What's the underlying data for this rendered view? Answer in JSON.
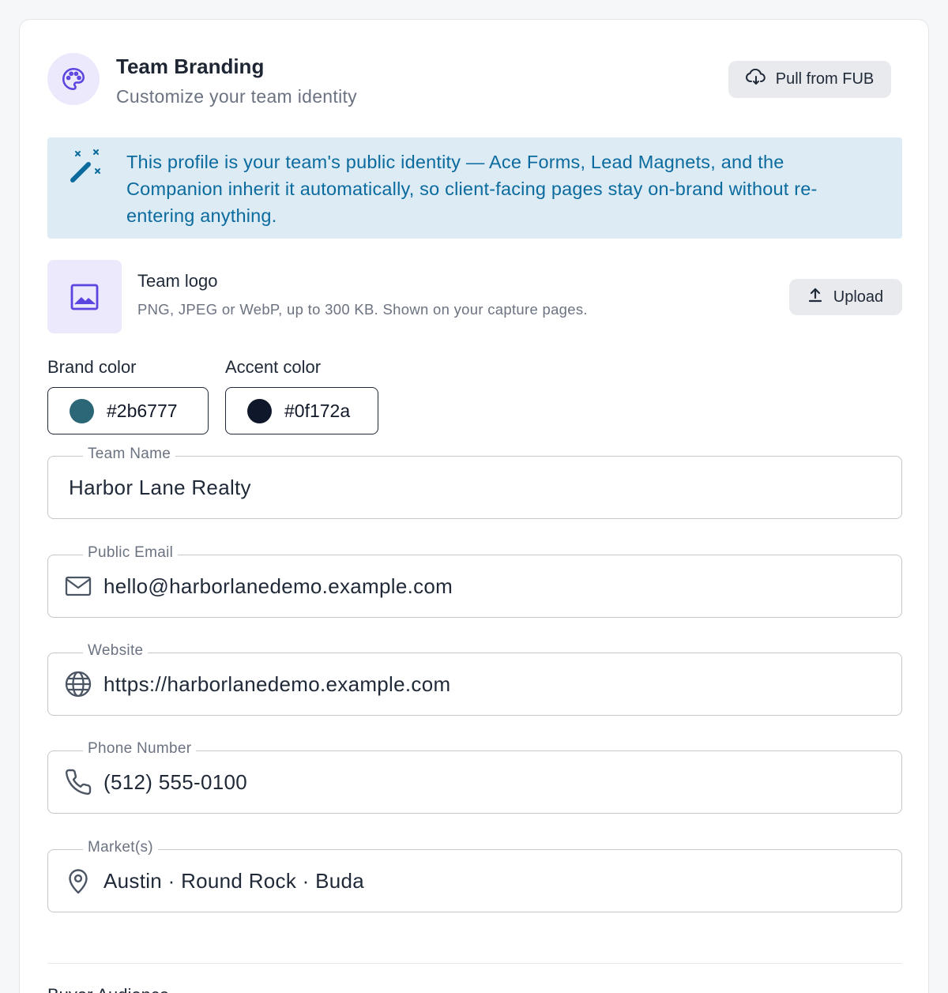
{
  "header": {
    "title": "Team Branding",
    "subtitle": "Customize your team identity",
    "pull_label": "Pull from FUB",
    "icon": "palette-icon"
  },
  "info": {
    "text": "This profile is your team's public identity — Ace Forms, Lead Magnets, and the Companion inherit it automatically, so client-facing pages stay on-brand without re-entering anything.",
    "icon": "magic-wand-icon"
  },
  "logo": {
    "title": "Team logo",
    "description": "PNG, JPEG or WebP, up to 300 KB. Shown on your capture pages.",
    "upload_label": "Upload"
  },
  "colors": {
    "brand": {
      "label": "Brand color",
      "value": "#2b6777"
    },
    "accent": {
      "label": "Accent color",
      "value": "#0f172a"
    }
  },
  "fields": {
    "team_name": {
      "label": "Team Name",
      "value": "Harbor Lane Realty"
    },
    "email": {
      "label": "Public Email",
      "value": "hello@harborlanedemo.example.com",
      "icon": "mail-icon"
    },
    "website": {
      "label": "Website",
      "value": "https://harborlanedemo.example.com",
      "icon": "globe-icon"
    },
    "phone": {
      "label": "Phone Number",
      "value": "(512) 555-0100",
      "icon": "phone-icon"
    },
    "markets": {
      "label": "Market(s)",
      "value": "Austin · Round Rock · Buda",
      "icon": "map-pin-icon"
    }
  },
  "next_section": {
    "title": "Buyer Audience"
  },
  "theme": {
    "accent_purple": "#5b45e0",
    "info_text": "#0b6a9e",
    "info_bg": "#dcebf4"
  }
}
